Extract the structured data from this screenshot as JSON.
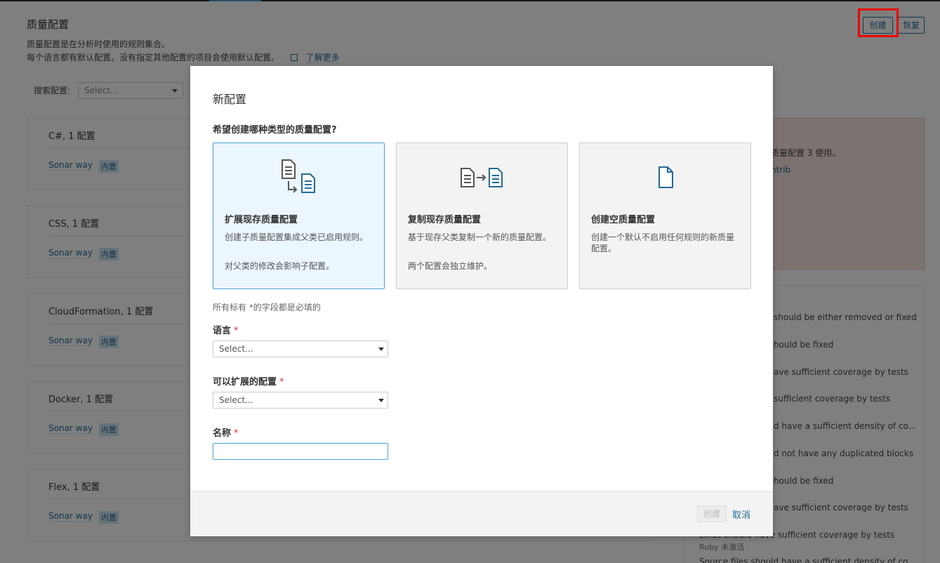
{
  "page": {
    "title": "质量配置",
    "desc1": "质量配置是在分析时使用的规则集合。",
    "desc2": "每个语言都有默认配置。没有指定其他配置的项目会使用默认配置。",
    "learn_more": "了解更多",
    "create_label": "创建",
    "restore_label": "恢复",
    "search_label": "搜索配置:",
    "search_placeholder": "Select..."
  },
  "languages": [
    {
      "title": "C#, 1 配置",
      "profile": "Sonar way",
      "badge": "内置"
    },
    {
      "title": "CSS, 1 配置",
      "profile": "Sonar way",
      "badge": "内置"
    },
    {
      "title": "CloudFormation, 1 配置",
      "profile": "Sonar way",
      "badge": "内置"
    },
    {
      "title": "Docker, 1 配置",
      "profile": "Sonar way",
      "badge": "内置"
    },
    {
      "title": "Flex, 1 配置",
      "profile": "Sonar way",
      "badge": "内置"
    }
  ],
  "right_panel": {
    "text1": "质量配置 3 使用。",
    "link": "ntrib",
    "rules": [
      "should be either removed or fixed",
      "hould be fixed",
      "ave sufficient coverage by tests",
      " sufficient coverage by tests",
      "d have a sufficient density of co...",
      "d not have any duplicated blocks",
      "hould be fixed",
      "ave sufficient coverage by tests",
      "Lines should have sufficient coverage by tests",
      "Source files should have a sufficient density of co..."
    ],
    "rule_sub": "Ruby 未激活"
  },
  "modal": {
    "title": "新配置",
    "question": "希望创建哪种类型的质量配置?",
    "options": [
      {
        "title": "扩展现存质量配置",
        "desc1": "创建子质量配置集成父类已启用规则。",
        "desc2": "对父类的修改会影响子配置。",
        "icon": "extend-profile-icon",
        "selected": true
      },
      {
        "title": "复制现存质量配置",
        "desc1": "基于现存父类复制一个新的质量配置。",
        "desc2": "两个配置会独立维护。",
        "icon": "copy-profile-icon",
        "selected": false
      },
      {
        "title": "创建空质量配置",
        "desc1": "创建一个默认不启用任何规则的新质量配置。",
        "desc2": "",
        "icon": "blank-file-icon",
        "selected": false
      }
    ],
    "required_note": "所有标有 *的字段都是必填的",
    "language_label": "语言",
    "language_placeholder": "Select...",
    "parent_label": "可以扩展的配置",
    "parent_placeholder": "Select...",
    "name_label": "名称",
    "name_value": "",
    "required_mark": "*",
    "create_label": "创建",
    "cancel_label": "取消"
  },
  "colors": {
    "accent": "#236a97",
    "selected_bg": "#ecf6fe",
    "selected_border": "#4b9fd5",
    "required": "#d02f3a",
    "highlight": "#ee0000"
  }
}
